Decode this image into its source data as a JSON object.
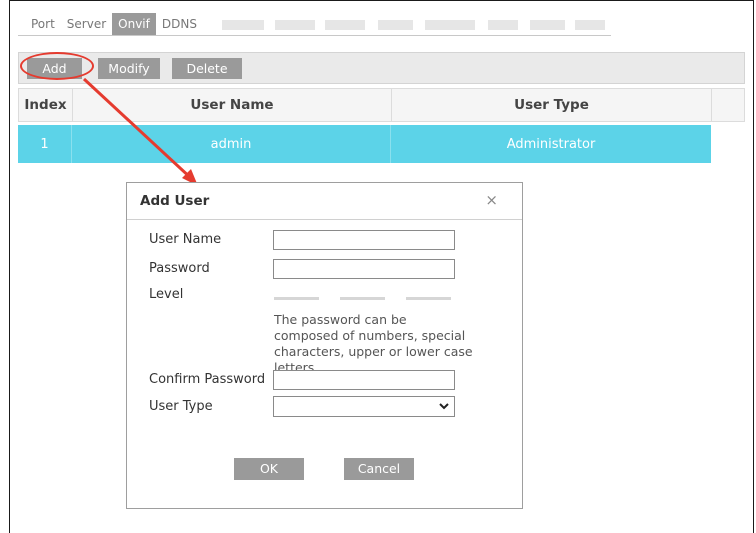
{
  "tabs": [
    {
      "label": "Port",
      "active": false
    },
    {
      "label": "Server",
      "active": false
    },
    {
      "label": "Onvif",
      "active": true
    },
    {
      "label": "DDNS",
      "active": false
    }
  ],
  "toolbar": {
    "add_label": "Add",
    "modify_label": "Modify",
    "delete_label": "Delete"
  },
  "table": {
    "columns": [
      "Index",
      "User Name",
      "User Type"
    ],
    "rows": [
      {
        "index": "1",
        "user_name": "admin",
        "user_type": "Administrator"
      }
    ]
  },
  "dialog": {
    "title": "Add User",
    "close_glyph": "×",
    "user_name_label": "User Name",
    "user_name_value": "",
    "password_label": "Password",
    "password_value": "",
    "level_label": "Level",
    "password_hint": "The password can be composed of numbers, special characters, upper or lower case letters.",
    "confirm_password_label": "Confirm Password",
    "confirm_password_value": "",
    "user_type_label": "User Type",
    "user_type_value": "",
    "ok_label": "OK",
    "cancel_label": "Cancel"
  },
  "colors": {
    "selected_row": "#5cd3e8",
    "button_gray": "#9a9a9a",
    "annotation_red": "#e53b2f"
  },
  "icons": {
    "close": "close-icon",
    "select_chevron": "chevron-down-icon"
  }
}
